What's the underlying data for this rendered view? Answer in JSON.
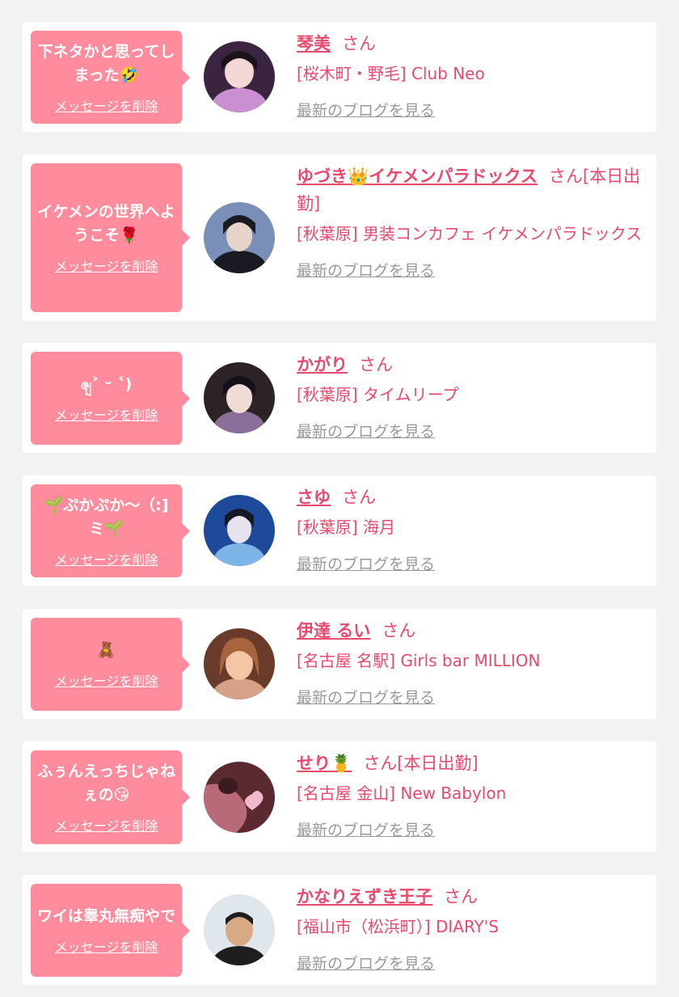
{
  "delete_label": "メッセージを削除",
  "san_label": "さん",
  "blog_label": "最新のブログを見る",
  "colors": {
    "accent": "#e84a6e",
    "bubble": "#ff8c9c",
    "muted": "#999999",
    "background": "#f2f2f2"
  },
  "cards": [
    {
      "message": "下ネタかと思ってしまった🤣",
      "name": "琴美",
      "suffix": "",
      "shop": "[桜木町・野毛] Club Neo",
      "avatar_colors": [
        "#3a2440",
        "#c98fd0",
        "#f3d6d6"
      ]
    },
    {
      "message": "イケメンの世界へようこそ🌹",
      "name": "ゆづき👑イケメンパラドックス",
      "suffix": "[本日出勤]",
      "shop": "[秋葉原] 男装コンカフェ イケメンパラドックス",
      "avatar_colors": [
        "#1a1a22",
        "#7a8fb8",
        "#e6d3c9"
      ]
    },
    {
      "message": "ၛ˃ ᵕ ˂)",
      "name": "かがり",
      "suffix": "",
      "shop": "[秋葉原] タイムリープ",
      "avatar_colors": [
        "#2b2326",
        "#8a6f9a",
        "#f0dcd6"
      ]
    },
    {
      "message": "🌱ぷかぷか～（:]ミ🌱",
      "name": "さゆ",
      "suffix": "",
      "shop": "[秋葉原] 海月",
      "avatar_colors": [
        "#1e4a9a",
        "#7db4e8",
        "#e9e3ef"
      ]
    },
    {
      "message": "🧸",
      "name": "伊達 るい",
      "suffix": "",
      "shop": "[名古屋 名駅] Girls bar MILLION",
      "avatar_colors": [
        "#6a3b2a",
        "#d7a088",
        "#f4c6a6"
      ]
    },
    {
      "message": "ふぅんえっちじゃねぇの😘",
      "name": "せり🍍",
      "suffix": "[本日出勤]",
      "shop": "[名古屋 金山] New Babylon",
      "avatar_colors": [
        "#5a2a30",
        "#b86a78",
        "#f3b9cc"
      ]
    },
    {
      "message": "ワイは睾丸無痴やで",
      "name": "かなりえずき王子",
      "suffix": "",
      "shop": "[福山市（松浜町）] DIARY'S",
      "avatar_colors": [
        "#dfe6ec",
        "#1e1e1e",
        "#d8a985"
      ]
    }
  ]
}
